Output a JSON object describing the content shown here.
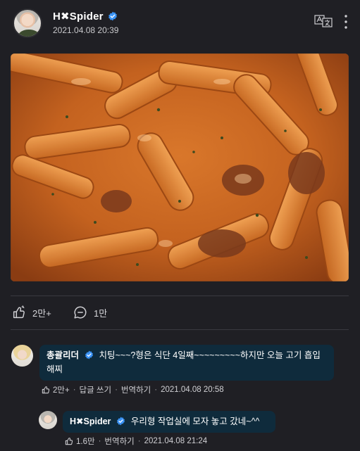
{
  "post": {
    "author": "H✖Spider",
    "date": "2021.04.08 20:39",
    "image_alt": "tteokbokki-food-photo",
    "likes": "2만+",
    "comments": "1만"
  },
  "comments": [
    {
      "author": "총괄리더",
      "text": "치팅~~~?형은 식단 4일째~~~~~~~~~하지만 오늘 고기 흡입 해찌",
      "likes": "2만+",
      "reply_label": "답글 쓰기",
      "translate_label": "번역하기",
      "date": "2021.04.08 20:58"
    },
    {
      "author": "H✖Spider",
      "text": "우리형 작업실에 모자 놓고 갔네~^^",
      "likes": "1.6만",
      "translate_label": "번역하기",
      "date": "2021.04.08 21:24"
    }
  ],
  "icons": {
    "verified": "verified-badge-icon",
    "translate": "translate-icon",
    "more": "more-vertical-icon",
    "like": "thumbs-up-icon",
    "comment": "comment-bubble-icon"
  },
  "colors": {
    "background": "#1f1f24",
    "bubble": "#0f2b3c",
    "verified": "#3b93f5"
  }
}
